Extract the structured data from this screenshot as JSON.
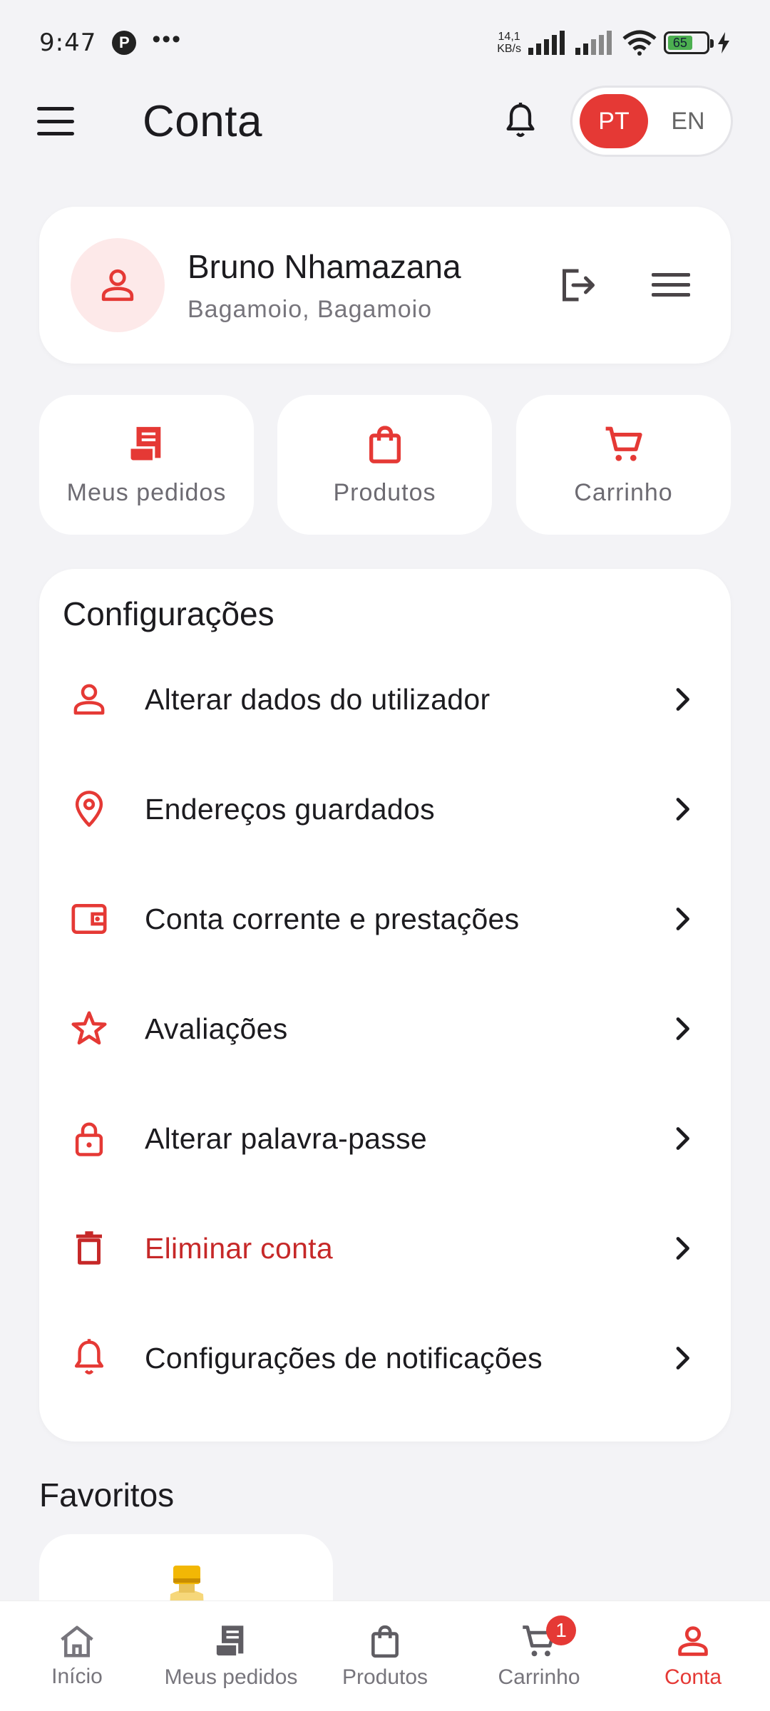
{
  "status_bar": {
    "time": "9:47",
    "pinterest_glyph": "P",
    "more": "•••",
    "net_speed_value": "14,1",
    "net_speed_unit": "KB/s",
    "battery": "65"
  },
  "app_bar": {
    "title": "Conta",
    "lang_active": "PT",
    "lang_other": "EN"
  },
  "profile": {
    "name": "Bruno Nhamazana",
    "location": "Bagamoio, Bagamoio"
  },
  "quick_actions": [
    {
      "label": "Meus pedidos",
      "icon": "receipt-icon"
    },
    {
      "label": "Produtos",
      "icon": "bag-icon"
    },
    {
      "label": "Carrinho",
      "icon": "cart-icon"
    }
  ],
  "settings": {
    "title": "Configurações",
    "items": [
      {
        "label": "Alterar dados do utilizador",
        "icon": "user-icon"
      },
      {
        "label": "Endereços guardados",
        "icon": "location-pin-icon"
      },
      {
        "label": "Conta corrente e prestações",
        "icon": "wallet-icon"
      },
      {
        "label": "Avaliações",
        "icon": "star-icon"
      },
      {
        "label": "Alterar palavra-passe",
        "icon": "lock-icon"
      },
      {
        "label": "Eliminar conta",
        "icon": "trash-icon"
      },
      {
        "label": "Configurações de notificações",
        "icon": "bell-icon"
      }
    ]
  },
  "favorites": {
    "title": "Favoritos"
  },
  "bottom_nav": {
    "items": [
      {
        "label": "Início",
        "icon": "home-icon"
      },
      {
        "label": "Meus pedidos",
        "icon": "receipt-icon"
      },
      {
        "label": "Produtos",
        "icon": "bag-icon"
      },
      {
        "label": "Carrinho",
        "icon": "cart-icon",
        "badge": "1"
      },
      {
        "label": "Conta",
        "icon": "user-icon",
        "active": true
      }
    ]
  },
  "colors": {
    "accent": "#e53935",
    "danger": "#c62828",
    "background": "#f3f3f6"
  }
}
